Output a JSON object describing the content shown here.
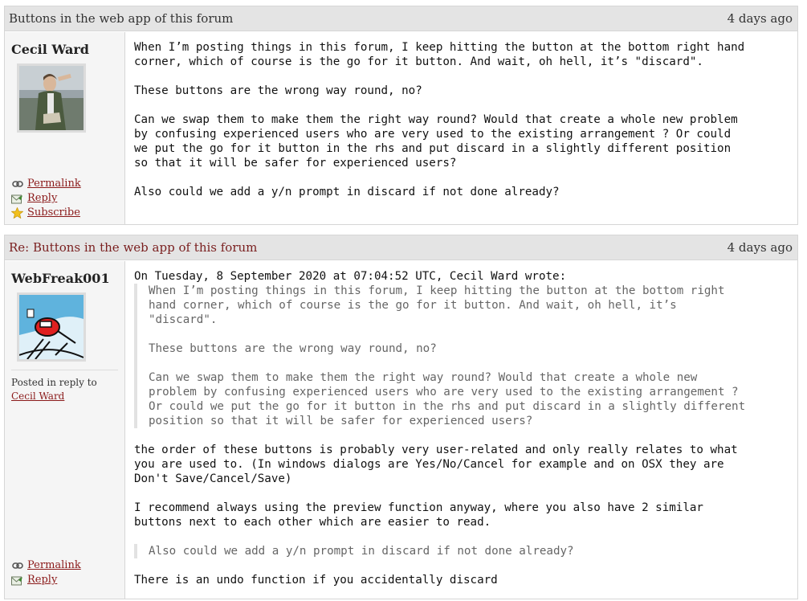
{
  "posts": [
    {
      "title": "Buttons in the web app of this forum",
      "date": "4 days ago",
      "author": "Cecil Ward",
      "actions": {
        "permalink": "Permalink",
        "reply": "Reply",
        "subscribe": "Subscribe"
      },
      "paragraphs": [
        "When I’m posting things in this forum, I keep hitting the button at the bottom right hand\ncorner, which of course is the go for it button. And wait, oh hell, it’s \"discard\".",
        "These buttons are the wrong way round, no?",
        "Can we swap them to make them the right way round? Would that create a whole new problem\nby confusing experienced users who are very used to the existing arrangement ? Or could\nwe put the go for it button in the rhs and put discard in a slightly different position\nso that it will be safer for experienced users?",
        "Also could we add a y/n prompt in discard if not done already?"
      ]
    },
    {
      "title": "Re: Buttons in the web app of this forum",
      "date": "4 days ago",
      "author": "WebFreak001",
      "reply_to_label": "Posted in reply to",
      "reply_to_author": "Cecil Ward",
      "actions": {
        "permalink": "Permalink",
        "reply": "Reply"
      },
      "attribution": "On Tuesday, 8 September 2020 at 07:04:52 UTC, Cecil Ward wrote:",
      "quote": [
        "When I’m posting things in this forum, I keep hitting the button at the bottom right\nhand corner, which of course is the go for it button. And wait, oh hell, it’s\n\"discard\".",
        "These buttons are the wrong way round, no?",
        "Can we swap them to make them the right way round? Would that create a whole new\nproblem by confusing experienced users who are very used to the existing arrangement ?\nOr could we put the go for it button in the rhs and put discard in a slightly different\nposition so that it will be safer for experienced users?"
      ],
      "reply_paragraph_1": "the order of these buttons is probably very user-related and only really relates to what\nyou are used to. (In windows dialogs are Yes/No/Cancel for example and on OSX they are\nDon't Save/Cancel/Save)",
      "reply_paragraph_2": "I recommend always using the preview function anyway, where you also have 2 similar\nbuttons next to each other which are easier to read.",
      "quote_2": "Also could we add a y/n prompt in discard if not done already?",
      "reply_paragraph_3": "There is an undo function if you accidentally discard"
    }
  ],
  "icons": {
    "permalink": "link-icon",
    "reply": "reply-icon",
    "subscribe": "star-icon"
  }
}
